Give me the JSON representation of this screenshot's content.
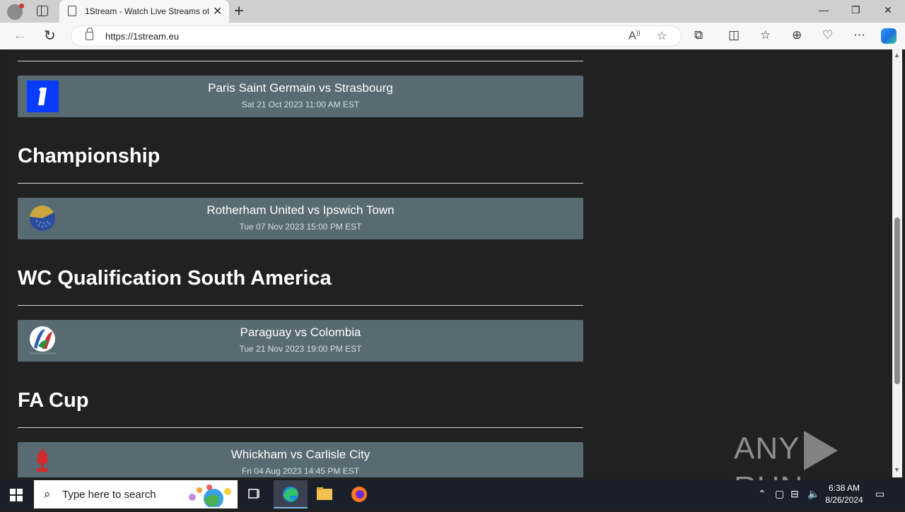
{
  "browser": {
    "tab_title": "1Stream - Watch Live Streams of",
    "url": "https://1stream.eu",
    "new_tab_glyph": "+"
  },
  "page": {
    "matches": [
      {
        "title": "Paris Saint Germain vs Strasbourg",
        "time": "Sat 21 Oct 2023 11:00 AM EST",
        "logo": "ligue1-icon"
      }
    ],
    "sections": [
      {
        "heading": "Championship",
        "match": {
          "title": "Rotherham United vs Ipswich Town",
          "time": "Tue 07 Nov 2023 15:00 PM EST",
          "logo": "championship-icon"
        }
      },
      {
        "heading": "WC Qualification South America",
        "match": {
          "title": "Paraguay vs Colombia",
          "time": "Tue 21 Nov 2023 19:00 PM EST",
          "logo": "wc-qualification-icon"
        }
      },
      {
        "heading": "FA Cup",
        "match": {
          "title": "Whickham vs Carlisle City",
          "time": "Fri 04 Aug 2023 14:45 PM EST",
          "logo": "fa-cup-icon"
        }
      }
    ]
  },
  "watermark": {
    "left": "ANY",
    "right": "RUN"
  },
  "taskbar": {
    "search_placeholder": "Type here to search",
    "time": "6:38 AM",
    "date": "8/26/2024"
  },
  "colors": {
    "card_bg": "#586a72",
    "page_bg": "#212121"
  }
}
